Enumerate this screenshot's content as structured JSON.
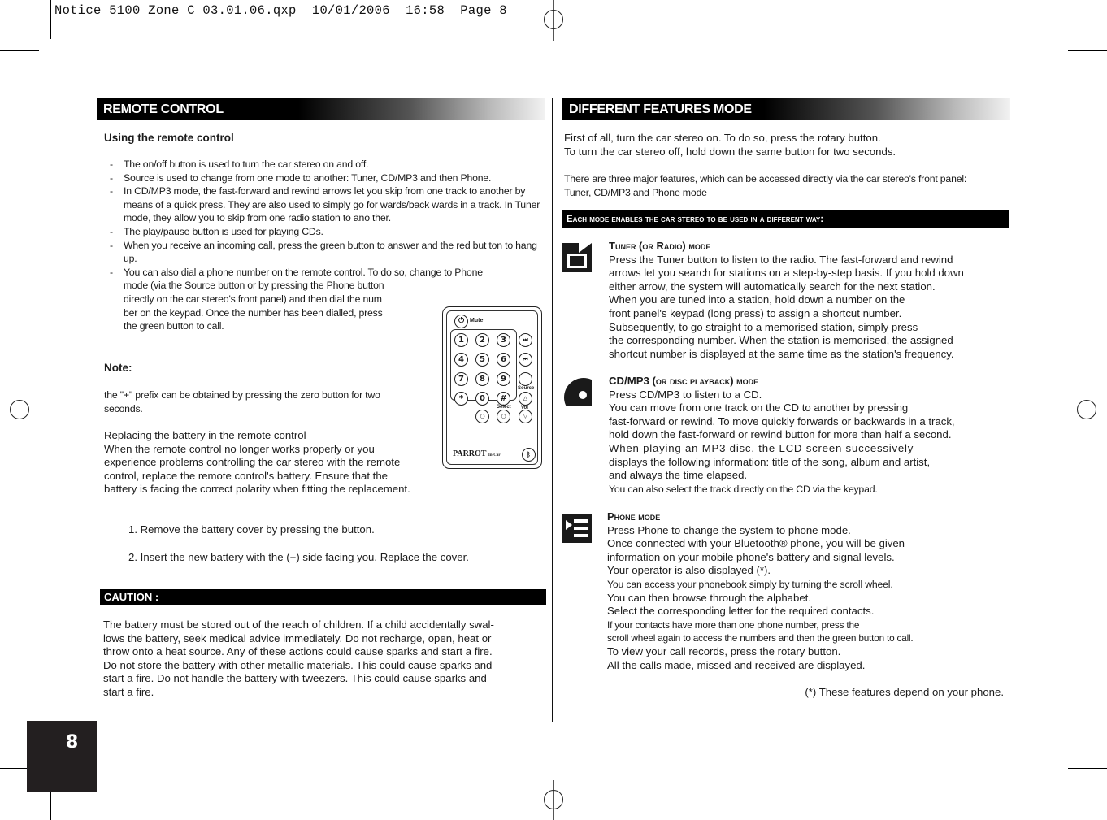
{
  "slug": "Notice 5100 Zone C 03.01.06.qxp  10/01/2006  16:58  Page 8",
  "page_number": "8",
  "left": {
    "banner": "REMOTE CONTROL",
    "subheading": "Using the remote control",
    "bullets": [
      "The on/off button is used to turn the car stereo on and off.",
      "Source is used to change from one mode to another: Tuner, CD/MP3 and then Phone.",
      "In CD/MP3 mode, the fast-forward and rewind arrows let you skip from one track to another by means of a quick press. They are also used to simply go for wards/back wards in a track. In Tuner mode, they allow you to skip from one radio station to ano ther.",
      "The play/pause button is used for playing CDs.",
      "When you receive an incoming call, press the green button to answer and the red but ton to hang up."
    ],
    "bullet_dial": {
      "line1": "You can also dial a phone number on the remote control. To do so, change to Phone",
      "rest": [
        "mode (via the Source button or by pressing the Phone button",
        "directly on the car stereo's front panel) and then dial the num",
        "ber on the keypad. Once the number has been dialled, press",
        "the green button to call."
      ]
    },
    "note_label": "Note:",
    "note_lines": [
      "the \"+\" prefix can be obtained by pressing the zero button for two",
      "seconds."
    ],
    "battery_lines": [
      "Replacing the battery in the remote control",
      "When the remote control no longer works properly or you",
      "experience problems controlling the car stereo with the remote",
      "control, replace the remote control's battery. Ensure that the",
      "battery is facing the correct polarity when fitting the replacement."
    ],
    "steps": [
      "1. Remove the battery cover by pressing the button.",
      "2. Insert the new battery with the (+) side facing you. Replace the cover."
    ],
    "caution_label": "CAUTION :",
    "caution_lines": [
      "The battery must be stored out of the reach of children. If a child accidentally swal-",
      "lows the battery, seek medical advice immediately. Do not recharge, open, heat or",
      "throw onto a heat source. Any of these actions could cause sparks and start a fire.",
      "Do not store the battery with other metallic materials. This could cause sparks and",
      "start a fire. Do not handle the battery with tweezers. This could cause sparks and",
      "start a fire."
    ],
    "remote": {
      "mute_label": "Mute",
      "keys": [
        "1",
        "2",
        "3",
        "4",
        "5",
        "6",
        "7",
        "8",
        "9",
        "*",
        "0",
        "#"
      ],
      "source_label": "Source",
      "select_label": "Select",
      "vol_label": "Vol",
      "brand": "PARROT",
      "brand_sub": "In-Car"
    }
  },
  "right": {
    "banner": "DIFFERENT FEATURES MODE",
    "intro": [
      "First of all, turn the car stereo on. To do so, press the rotary button.",
      "To turn the car stereo off, hold down the same button for two seconds."
    ],
    "features": [
      "There are three major features, which can be accessed directly via the car stereo's front panel:",
      "Tuner, CD/MP3 and Phone mode"
    ],
    "sub_banner": "Each mode enables the car stereo to be used in a different way:",
    "modes": [
      {
        "icon": "radio-icon",
        "title": "Tuner (or Radio) mode",
        "lines": [
          "Press the Tuner button to listen to the radio. The fast-forward and rewind",
          "arrows let you search for stations on a step-by-step basis. If you hold down",
          "either arrow, the system will automatically search for the next station.",
          "When you are tuned into a station, hold down a number on the",
          "front panel's keypad (long press) to assign a shortcut number.",
          "Subsequently, to go straight to a memorised station, simply press",
          "the corresponding number. When the station is memorised, the assigned",
          "shortcut number is displayed at the same time as the station's frequency."
        ]
      },
      {
        "icon": "disc-icon",
        "title_main": "CD/MP3",
        "title": "(or disc playback) mode",
        "lines": [
          "Press CD/MP3 to listen to a CD.",
          "You can move from one track on the CD to another by pressing",
          "fast-forward or rewind. To move quickly forwards or backwards in a track,",
          "hold down the fast-forward or rewind button for more than half a second.",
          "When playing an MP3 disc, the LCD screen successively",
          "displays the following information: title of the song, album and artist,",
          "and always the time elapsed.",
          "You can also select the track directly on the CD via the keypad."
        ]
      },
      {
        "icon": "phone-list-icon",
        "title": "Phone mode",
        "lines": [
          "Press Phone to change the system to phone mode.",
          "Once connected with your Bluetooth® phone, you will be given",
          "information on your mobile phone's battery and signal levels.",
          "Your operator is also displayed (*).",
          "You can access your phonebook simply by turning the scroll wheel.",
          "You can then browse through the alphabet.",
          "Select the corresponding letter for the required contacts.",
          "If your contacts have more than one phone number, press the",
          "scroll wheel again to access the numbers and then the green button to call.",
          "To view your call records, press the rotary button.",
          "All the calls made, missed and received are displayed."
        ]
      }
    ],
    "footnote": "(*) These features depend on your phone."
  }
}
